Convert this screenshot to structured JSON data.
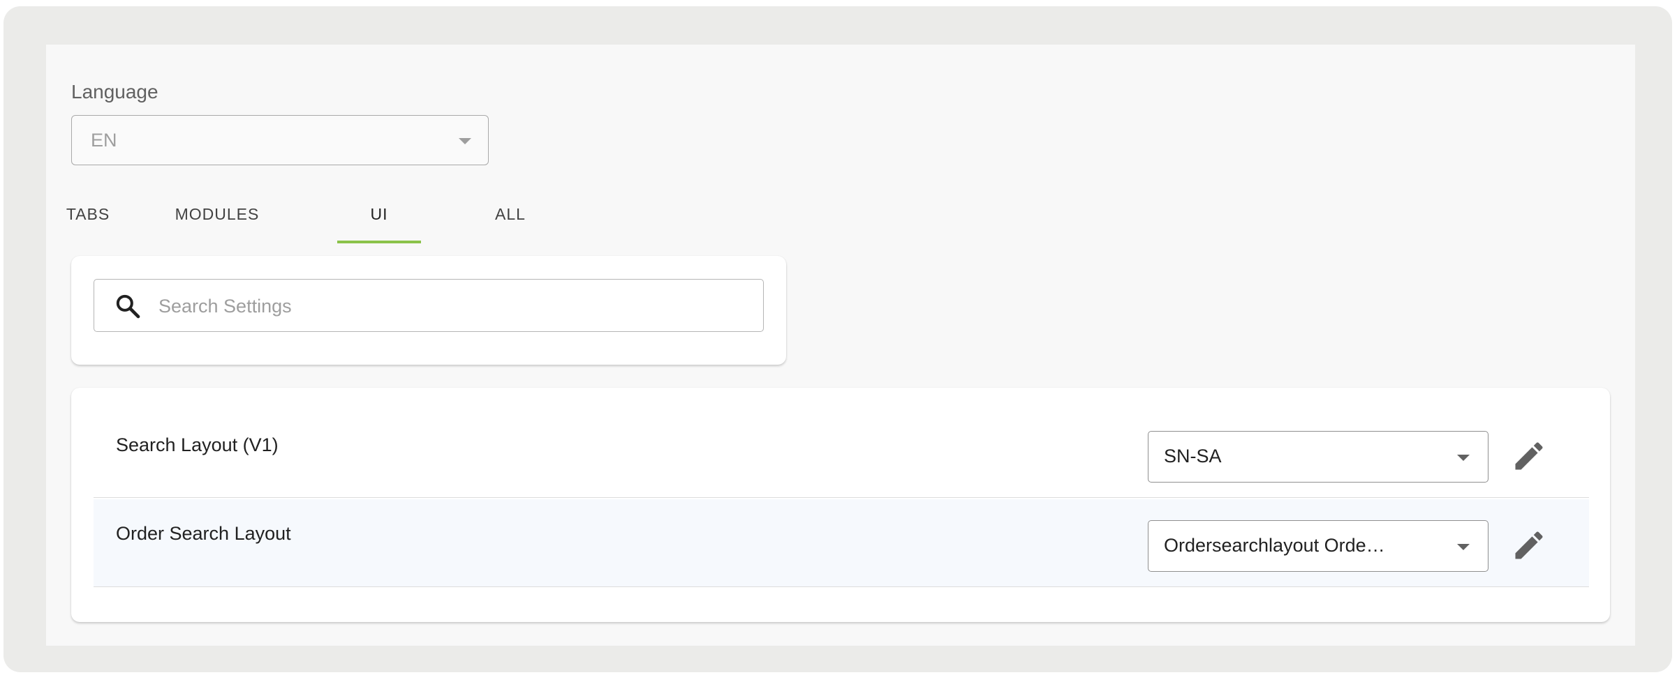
{
  "language": {
    "label": "Language",
    "selected": "EN"
  },
  "tabs": [
    {
      "label": "TABS"
    },
    {
      "label": "MODULES"
    },
    {
      "label": "UI",
      "active": true
    },
    {
      "label": "ALL"
    }
  ],
  "search": {
    "placeholder": "Search Settings",
    "value": ""
  },
  "settings": [
    {
      "label": "Search Layout (V1)",
      "value": "SN-SA"
    },
    {
      "label": "Order Search Layout",
      "value": "Ordersearchlayout Orde…"
    }
  ],
  "colors": {
    "accent": "#8bc34a",
    "frame": "#ebebe9",
    "panel": "#f8f8f8",
    "highlight_row": "#f6f9fd"
  },
  "icons": {
    "search": "search-icon",
    "edit": "pencil-icon",
    "dropdown": "caret-down-icon"
  }
}
